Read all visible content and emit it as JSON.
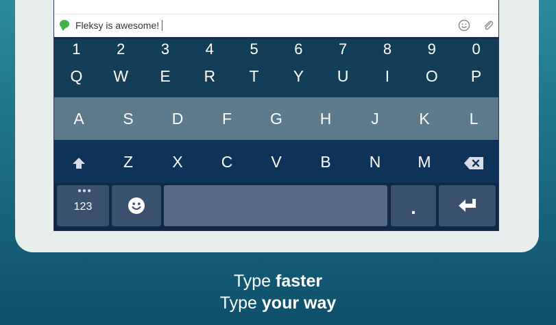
{
  "message": {
    "text": "Fleksy is awesome!",
    "status_icon": "green-speech-bubble-icon",
    "emoji_icon": "smiley-icon",
    "attach_icon": "paperclip-icon"
  },
  "keyboard": {
    "number_row": [
      "1",
      "2",
      "3",
      "4",
      "5",
      "6",
      "7",
      "8",
      "9",
      "0"
    ],
    "row1": [
      "Q",
      "W",
      "E",
      "R",
      "T",
      "Y",
      "U",
      "I",
      "O",
      "P"
    ],
    "row2": [
      "A",
      "S",
      "D",
      "F",
      "G",
      "H",
      "J",
      "K",
      "L"
    ],
    "row3": [
      "Z",
      "X",
      "C",
      "V",
      "B",
      "N",
      "M"
    ],
    "shift_icon": "shift-arrow-icon",
    "backspace_icon": "backspace-icon",
    "numbers_key_label": "123",
    "emoji_key_icon": "smiley-icon",
    "period_label": ".",
    "return_icon": "return-arrow-icon"
  },
  "tagline": {
    "line1_prefix": "Type ",
    "line1_bold": "faster",
    "line2_prefix": "Type ",
    "line2_bold": "your way"
  }
}
